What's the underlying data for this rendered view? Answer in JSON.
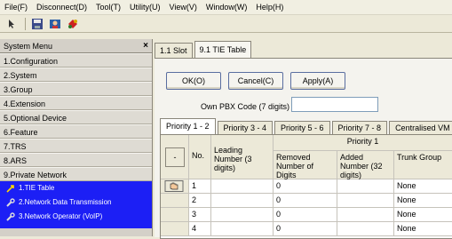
{
  "menu": {
    "items": [
      {
        "label": "File(F)"
      },
      {
        "label": "Disconnect(D)"
      },
      {
        "label": "Tool(T)"
      },
      {
        "label": "Utility(U)"
      },
      {
        "label": "View(V)"
      },
      {
        "label": "Window(W)"
      },
      {
        "label": "Help(H)"
      }
    ]
  },
  "toolbar": {
    "icons": [
      "help-pointer-icon",
      "save-icon",
      "user-icon",
      "plugin-icon"
    ]
  },
  "sidebar": {
    "title": "System Menu",
    "close": "×",
    "items": [
      {
        "label": "1.Configuration"
      },
      {
        "label": "2.System"
      },
      {
        "label": "3.Group"
      },
      {
        "label": "4.Extension"
      },
      {
        "label": "5.Optional Device"
      },
      {
        "label": "6.Feature"
      },
      {
        "label": "7.TRS"
      },
      {
        "label": "8.ARS"
      },
      {
        "label": "9.Private Network"
      }
    ],
    "subitems": [
      {
        "label": "1.TIE Table"
      },
      {
        "label": "2.Network Data Transmission"
      },
      {
        "label": "3.Network Operator (VoIP)"
      }
    ]
  },
  "main": {
    "tabs": [
      {
        "label": "1.1 Slot"
      },
      {
        "label": "9.1 TIE Table"
      }
    ],
    "buttons": {
      "ok": "OK(O)",
      "cancel": "Cancel(C)",
      "apply": "Apply(A)"
    },
    "pbx_label": "Own PBX Code (7 digits)",
    "pbx_value": "",
    "priority_tabs": [
      {
        "label": "Priority 1 - 2"
      },
      {
        "label": "Priority 3 - 4"
      },
      {
        "label": "Priority 5 - 6"
      },
      {
        "label": "Priority 7 - 8"
      },
      {
        "label": "Centralised VM"
      }
    ],
    "table": {
      "dash": "-",
      "no": "No.",
      "leading": "Leading Number (3 digits)",
      "group_title": "Priority 1",
      "removed": "Removed Number of Digits",
      "added": "Added Number (32 digits)",
      "trunk": "Trunk Group",
      "rows": [
        {
          "no": "1",
          "removed": "0",
          "trunk": "None"
        },
        {
          "no": "2",
          "removed": "0",
          "trunk": "None"
        },
        {
          "no": "3",
          "removed": "0",
          "trunk": "None"
        },
        {
          "no": "4",
          "removed": "0",
          "trunk": "None"
        }
      ]
    }
  }
}
